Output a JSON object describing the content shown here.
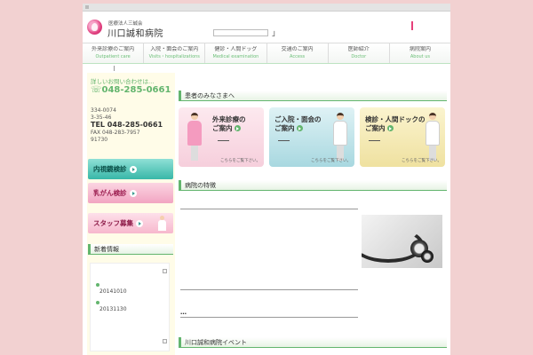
{
  "header": {
    "corporation": "医療法人三誠会",
    "hospital_name": "川口誠和病院",
    "bracket": "」"
  },
  "nav": [
    {
      "ja": "外来診療のご案内",
      "en": "Outpatient care"
    },
    {
      "ja": "入院・面会のご案内",
      "en": "Visits・hospitalizations"
    },
    {
      "ja": "健診・人間ドッグ",
      "en": "Medical examination"
    },
    {
      "ja": "交通のご案内",
      "en": "Access"
    },
    {
      "ja": "医師紹介",
      "en": "Doctor"
    },
    {
      "ja": "病院案内",
      "en": "About us"
    }
  ],
  "sidebar": {
    "contact_lead": "詳しいお問い合わせは…",
    "contact_phone": "048-285-0661",
    "address_line1": "334-0074",
    "address_line2": "3-35-46",
    "tel": "TEL 048-285-0661",
    "fax": "FAX 048-283-7957",
    "fax_code": "91730",
    "banner_endoscopy": "内視鏡検診",
    "banner_breast": "乳がん検診",
    "banner_staff": "スタッフ募集",
    "news_title": "新着情報",
    "news": [
      {
        "date": "20141010"
      },
      {
        "date": "20131130"
      }
    ]
  },
  "main": {
    "patients_title": "患者のみなさまへ",
    "cards": [
      {
        "line1": "外来診療の",
        "line2": "ご案内",
        "more": "こちらをご覧下さい。"
      },
      {
        "line1": "ご入院・面会の",
        "line2": "ご案内",
        "more": "こちらをご覧下さい。"
      },
      {
        "line1": "検診・人間ドックの",
        "line2": "ご案内",
        "more": "こちらをご覧下さい。"
      }
    ],
    "features_title": "病院の特徴",
    "features_ellipsis": "…",
    "events_title": "川口誠和病院イベント"
  }
}
